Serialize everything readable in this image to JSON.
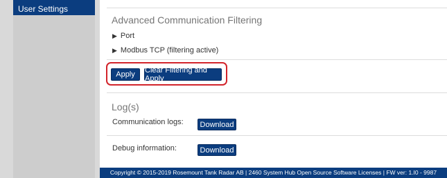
{
  "sidebar": {
    "items": [
      {
        "label": "User Settings"
      }
    ]
  },
  "filtering": {
    "title": "Advanced Communication Filtering",
    "tree": [
      {
        "label": "Port"
      },
      {
        "label": "Modbus TCP (filtering active)"
      }
    ],
    "apply_label": "Apply",
    "clear_apply_label": "Clear Filtering and Apply"
  },
  "logs": {
    "title": "Log(s)",
    "rows": [
      {
        "label": "Communication logs:",
        "button": "Download"
      },
      {
        "label": "Debug information:",
        "button": "Download"
      }
    ]
  },
  "footer": {
    "text": "Copyright © 2015-2019 Rosemount Tank Radar AB | 2460 System Hub Open Source Software Licenses | FW ver: 1.I0 - 9987"
  },
  "colors": {
    "primary": "#0b3d7f",
    "highlight": "#d2232a"
  }
}
